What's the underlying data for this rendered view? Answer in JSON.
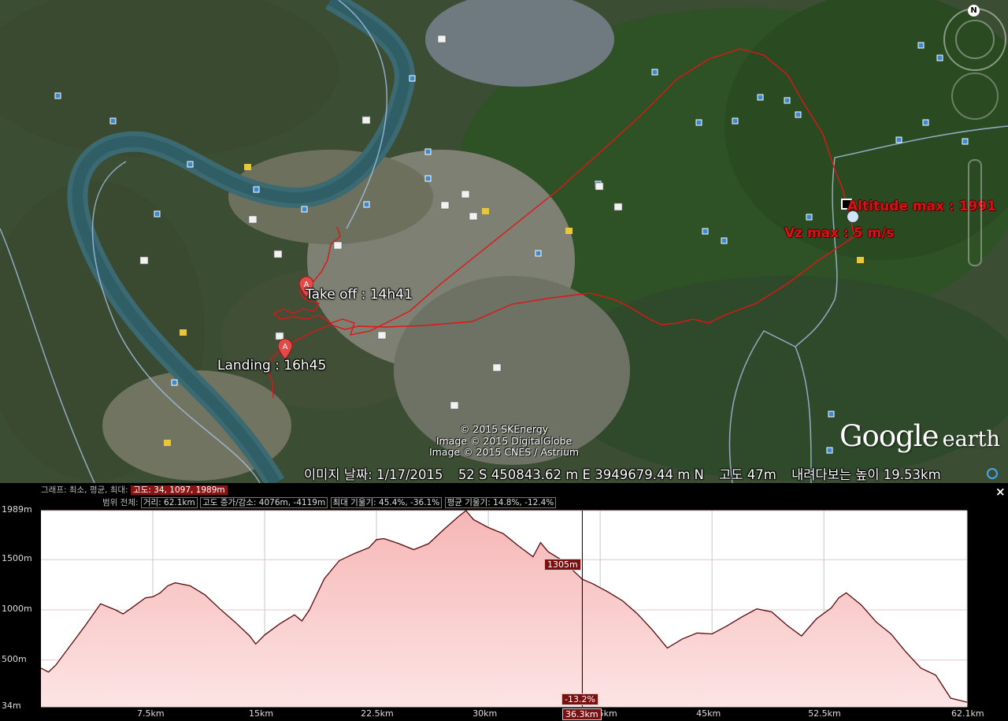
{
  "map": {
    "labels": {
      "altitude_max": "Altitude max : 1991",
      "vz_max": "Vz max : 5 m/s",
      "take_off": "Take off : 14h41",
      "landing": "Landing : 16h45"
    },
    "attribution": [
      "© 2015 SKEnergy",
      "Image © 2015 DigitalGlobe",
      "Image © 2015 CNES / Astrium"
    ],
    "logo": {
      "google": "Google",
      "earth": "earth"
    },
    "compass_north": "N",
    "status": {
      "image_date": "이미지 날짜: 1/17/2015",
      "coords": "52 S 450843.62 m E 3949679.44 m N",
      "elevation": "고도     47m",
      "eye_alt": "내려다보는 높이  19.53km"
    },
    "colors": {
      "track": "#e01515",
      "border_line": "#a9c3e8",
      "accent": "#8b1515"
    },
    "pin_label": "A"
  },
  "profile": {
    "info_row1": {
      "prefix": "그래프: 최소, 평균, 최대:",
      "values": "고도: 34, 1097, 1989m"
    },
    "info_row2": {
      "prefix": "범위 전체:",
      "distance": "거리: 62.1km",
      "elev_gain": "고도 증가/감소: 4076m, -4119m",
      "slope": "최대 기울기: 45.4%, -36.1%",
      "avg_slope": "평균 기울기: 14.8%, -12.4%"
    },
    "close_label": "×",
    "cursor": {
      "elevation": "1305m",
      "slope": "-13.2%",
      "distance": "36.3km"
    }
  },
  "chart_data": {
    "type": "area",
    "xlabel": "",
    "ylabel": "",
    "xlim": [
      0,
      62.1
    ],
    "ylim": [
      34,
      1989
    ],
    "x_ticks": [
      "7.5km",
      "15km",
      "22.5km",
      "30km",
      "37.5km",
      "45km",
      "52.5km",
      "62.1km"
    ],
    "x_tick_values": [
      7.5,
      15,
      22.5,
      30,
      37.5,
      45,
      52.5,
      62.1
    ],
    "y_ticks": [
      "1989m",
      "1500m",
      "1000m",
      "500m",
      "34m"
    ],
    "y_tick_values": [
      1989,
      1500,
      1000,
      500,
      34
    ],
    "grid": true,
    "series": [
      {
        "x": [
          0,
          0.5,
          1,
          2,
          3,
          4,
          5,
          5.5,
          6,
          7,
          7.5,
          8,
          8.5,
          9,
          10,
          11,
          12,
          13,
          14,
          14.4,
          15,
          16,
          17,
          17.5,
          18,
          19,
          20,
          21,
          22,
          22.5,
          23,
          24,
          25,
          26,
          27,
          28,
          28.5,
          29,
          30,
          31,
          32,
          33,
          33.5,
          34,
          35,
          36.3,
          37,
          38,
          39,
          40,
          41,
          42,
          43,
          44,
          45,
          46,
          47,
          48,
          49,
          50,
          51,
          52,
          53,
          53.5,
          54,
          55,
          56,
          57,
          58,
          59,
          60,
          61,
          62.1
        ],
        "values": [
          420,
          380,
          450,
          650,
          850,
          1060,
          1000,
          960,
          1010,
          1120,
          1130,
          1170,
          1240,
          1270,
          1240,
          1150,
          1010,
          880,
          740,
          660,
          750,
          860,
          950,
          890,
          1000,
          1310,
          1490,
          1560,
          1620,
          1700,
          1710,
          1660,
          1600,
          1660,
          1800,
          1930,
          1989,
          1900,
          1820,
          1760,
          1640,
          1530,
          1670,
          1580,
          1490,
          1305,
          1260,
          1180,
          1090,
          960,
          800,
          620,
          710,
          770,
          760,
          840,
          930,
          1010,
          980,
          850,
          740,
          910,
          1020,
          1120,
          1170,
          1050,
          880,
          760,
          580,
          420,
          350,
          120,
          80
        ]
      }
    ]
  }
}
